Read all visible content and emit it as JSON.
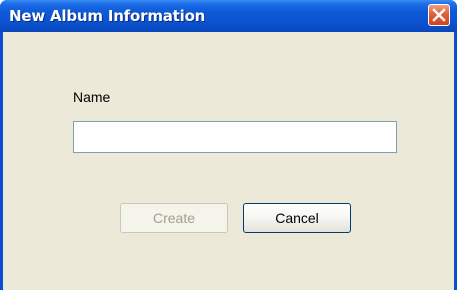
{
  "window": {
    "title": "New Album Information"
  },
  "icons": {
    "close": "close-icon"
  },
  "form": {
    "name_label": "Name",
    "name_value": "",
    "name_placeholder": ""
  },
  "buttons": {
    "create_label": "Create",
    "create_enabled": false,
    "cancel_label": "Cancel"
  },
  "colors": {
    "titlebar": "#0b55d4",
    "client_background": "#ece9d8",
    "close_button": "#e0603a",
    "input_border": "#7f9db9"
  }
}
